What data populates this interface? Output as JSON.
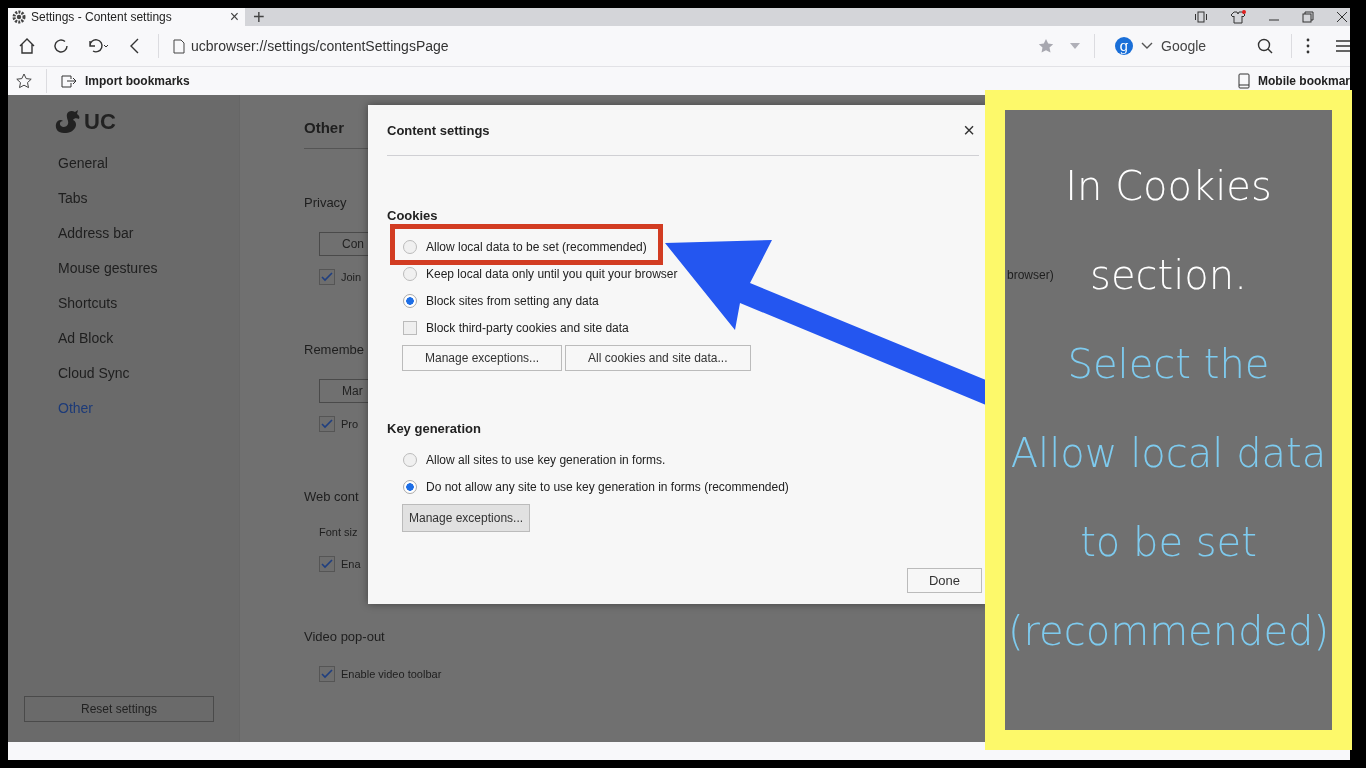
{
  "tab": {
    "title": "Settings - Content settings",
    "close": "×",
    "new_tab": "+"
  },
  "address_bar": {
    "url": "ucbrowser://settings/contentSettingsPage"
  },
  "search_engine": {
    "badge": "g",
    "name": "Google"
  },
  "bookmarks_bar": {
    "import": "Import bookmarks",
    "mobile": "Mobile bookmar"
  },
  "sidebar": {
    "logo": "UC",
    "items": [
      {
        "label": "General",
        "selected": false
      },
      {
        "label": "Tabs",
        "selected": false
      },
      {
        "label": "Address bar",
        "selected": false
      },
      {
        "label": "Mouse gestures",
        "selected": false
      },
      {
        "label": "Shortcuts",
        "selected": false
      },
      {
        "label": "Ad Block",
        "selected": false
      },
      {
        "label": "Cloud Sync",
        "selected": false
      },
      {
        "label": "Other",
        "selected": true
      }
    ],
    "reset_button": "Reset settings"
  },
  "main": {
    "title": "Other",
    "trailing_text": "browser)",
    "sections": [
      {
        "heading": "Privacy",
        "items": [
          {
            "kind": "button",
            "label": "Con"
          },
          {
            "kind": "checkbox",
            "label": "Join",
            "checked": true
          }
        ]
      },
      {
        "heading": "Remembe",
        "items": [
          {
            "kind": "button",
            "label": "Mar"
          },
          {
            "kind": "checkbox",
            "label": "Pro",
            "checked": true
          }
        ]
      },
      {
        "heading": "Web cont",
        "items": [
          {
            "kind": "label",
            "label": "Font siz"
          },
          {
            "kind": "checkbox",
            "label": "Ena",
            "checked": true
          }
        ]
      },
      {
        "heading": "Video pop-out",
        "items": [
          {
            "kind": "checkbox",
            "label": "Enable video toolbar",
            "checked": true
          }
        ]
      }
    ]
  },
  "dialog": {
    "title": "Content settings",
    "close": "×",
    "sections": [
      {
        "heading": "Cookies",
        "options": [
          {
            "kind": "radio",
            "label": "Allow local data to be set (recommended)",
            "selected": false,
            "highlighted": true
          },
          {
            "kind": "radio",
            "label": "Keep local data only until you quit your browser",
            "selected": false
          },
          {
            "kind": "radio",
            "label": "Block sites from setting any data",
            "selected": true
          },
          {
            "kind": "checkbox",
            "label": "Block third-party cookies and site data",
            "checked": false
          }
        ],
        "buttons": [
          {
            "label": "Manage exceptions...",
            "shaded": false
          },
          {
            "label": "All cookies and site data...",
            "shaded": false
          }
        ]
      },
      {
        "heading": "Key generation",
        "options": [
          {
            "kind": "radio",
            "label": "Allow all sites to use key generation in forms.",
            "selected": false
          },
          {
            "kind": "radio",
            "label": "Do not allow any site to use key generation in forms (recommended)",
            "selected": true
          }
        ],
        "buttons": [
          {
            "label": "Manage exceptions...",
            "shaded": true
          }
        ]
      }
    ],
    "done_button": "Done"
  },
  "annotation": {
    "lines": [
      {
        "text": "In Cookies",
        "color": "#ffffff"
      },
      {
        "text": "section.",
        "color": "#ffffff"
      },
      {
        "text": "Select the",
        "color": "#7ecbef"
      },
      {
        "text": "Allow local data",
        "color": "#7ecbef"
      },
      {
        "text": "to be set",
        "color": "#7ecbef"
      },
      {
        "text": "(recommended)",
        "color": "#7ecbef"
      }
    ]
  }
}
